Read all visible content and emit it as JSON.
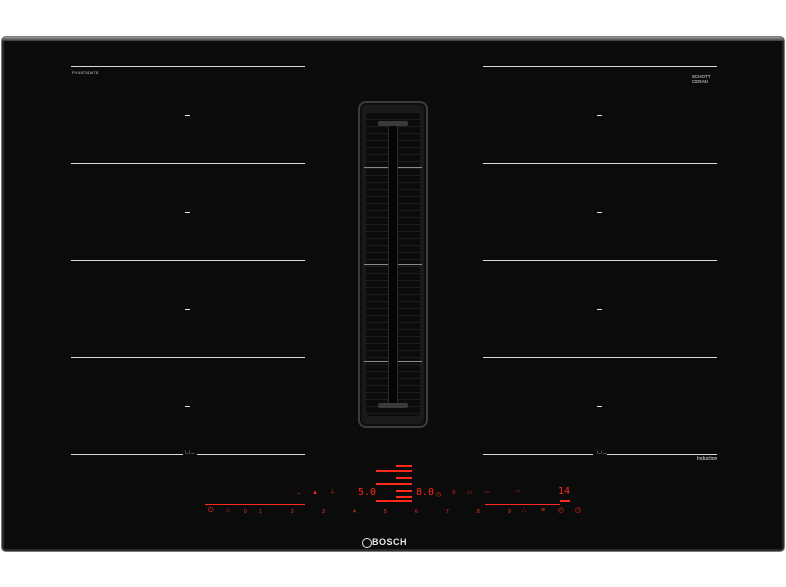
{
  "hob": {
    "model_code": "PXX875D67E",
    "glass_brand": "SCHOTT\nCERAN",
    "glass_sub": "",
    "brand": "BOSCH",
    "induction_label": "Induction",
    "flex_symbol_left": "└┘─",
    "flex_symbol_right": "└┘─"
  },
  "controls": {
    "power_display": "5.0",
    "timer_display": "8.0",
    "right_display": "14",
    "scale_numbers": [
      "0",
      "1",
      "2",
      "3",
      "4",
      "5",
      "6",
      "7",
      "8",
      "9"
    ],
    "colors": {
      "accent": "#ff2a1a",
      "glass": "#0b0b0c",
      "line": "#d9d9d9"
    }
  }
}
